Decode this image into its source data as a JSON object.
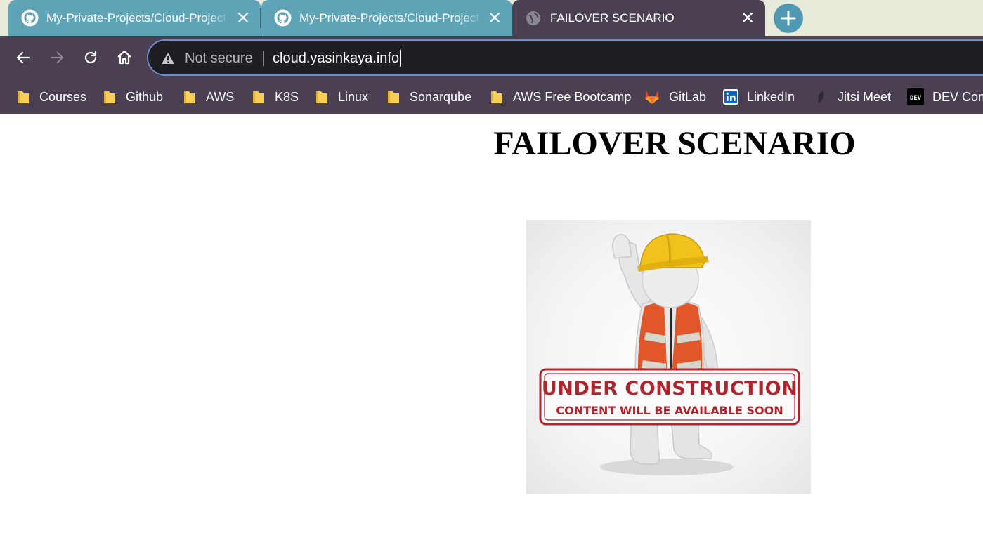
{
  "browser": {
    "tabs": [
      {
        "title": "My-Private-Projects/Cloud-Project",
        "icon": "github-icon",
        "active": false
      },
      {
        "title": "My-Private-Projects/Cloud-Project",
        "icon": "github-icon",
        "active": false
      },
      {
        "title": "FAILOVER SCENARIO",
        "icon": "globe-icon",
        "active": true
      }
    ],
    "omnibox": {
      "security_label": "Not secure",
      "url": "cloud.yasinkaya.info"
    },
    "bookmarks": [
      {
        "label": "Courses",
        "icon": "folder-icon"
      },
      {
        "label": "Github",
        "icon": "folder-icon"
      },
      {
        "label": "AWS",
        "icon": "folder-icon"
      },
      {
        "label": "K8S",
        "icon": "folder-icon"
      },
      {
        "label": "Linux",
        "icon": "folder-icon"
      },
      {
        "label": "Sonarqube",
        "icon": "folder-icon"
      },
      {
        "label": "AWS Free Bootcamp",
        "icon": "folder-icon"
      },
      {
        "label": "GitLab",
        "icon": "gitlab-icon"
      },
      {
        "label": "LinkedIn",
        "icon": "linkedin-icon"
      },
      {
        "label": "Jitsi Meet",
        "icon": "jitsi-icon"
      },
      {
        "label": "DEV Com",
        "icon": "dev-icon"
      }
    ],
    "colors": {
      "tab_inactive": "#5fa3b7",
      "toolbar": "#4a4052",
      "omnibox_border": "#6f8ccf"
    }
  },
  "page": {
    "heading": "FAILOVER SCENARIO",
    "image": {
      "stamp_line1": "UNDER CONSTRUCTION",
      "stamp_line2": "CONTENT WILL BE AVAILABLE SOON"
    }
  }
}
